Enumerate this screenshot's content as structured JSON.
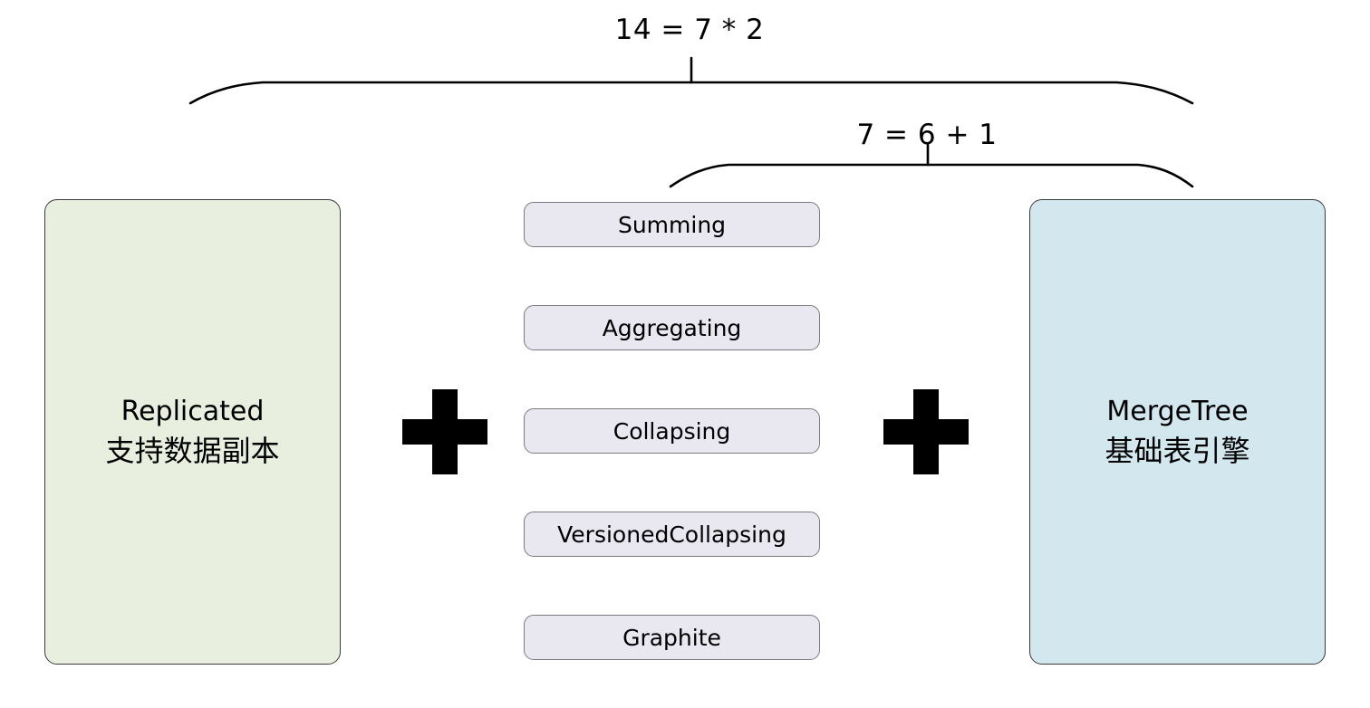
{
  "diagram": {
    "title_braces": [
      {
        "id": "top",
        "label": "14 = 7 * 2"
      },
      {
        "id": "mid",
        "label": "7 = 6 + 1"
      }
    ],
    "left_box": {
      "name_en": "Replicated",
      "name_zh": "支持数据副本",
      "fill": "#e9efdf"
    },
    "right_box": {
      "name_en": "MergeTree",
      "name_zh": "基础表引擎",
      "fill": "#d3e7ef"
    },
    "engine_variants": [
      {
        "label": "Summing"
      },
      {
        "label": "Aggregating"
      },
      {
        "label": "Collapsing"
      },
      {
        "label": "VersionedCollapsing"
      },
      {
        "label": "Graphite"
      }
    ],
    "operators": [
      {
        "symbol": "+",
        "position": "left"
      },
      {
        "symbol": "+",
        "position": "right"
      }
    ],
    "colors": {
      "pill_fill": "#e9e7ef",
      "pill_border": "#7a7a82",
      "box_border": "#3a3a3a",
      "stroke": "#000000",
      "background": "#ffffff"
    }
  }
}
